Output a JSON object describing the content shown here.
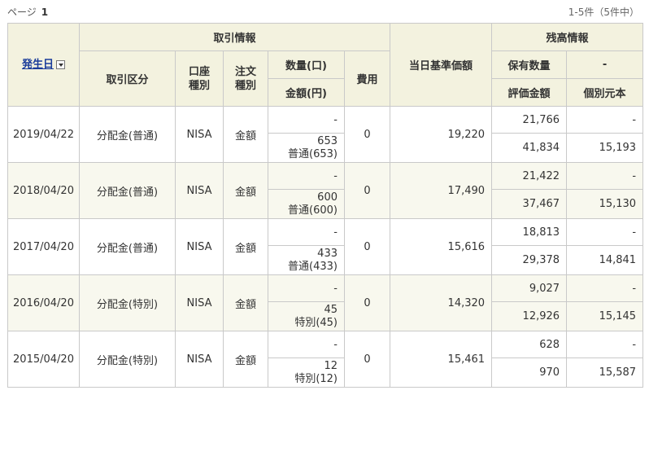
{
  "pager": {
    "label": "ページ",
    "current": "1",
    "count": "1-5件（5件中）"
  },
  "headers": {
    "date": "発生日",
    "torihiki_group": "取引情報",
    "torihiki_kubun": "取引区分",
    "koza": "口座\n種別",
    "chumon": "注文\n種別",
    "suryo": "数量(口)",
    "kingaku": "金額(円)",
    "hiyo": "費用",
    "kijun": "当日基準価額",
    "zandaka_group": "残高情報",
    "hoyu": "保有数量",
    "dash": "-",
    "hyoka": "評価金額",
    "kobetsu": "個別元本"
  },
  "rows": [
    {
      "date": "2019/04/22",
      "kubun": "分配金(普通)",
      "koza": "NISA",
      "chumon": "金額",
      "qty": "-",
      "amount": "653",
      "amount_detail": "普通(653)",
      "fee": "0",
      "nav": "19,220",
      "holding": "21,766",
      "dash": "-",
      "valuation": "41,834",
      "principal": "15,193"
    },
    {
      "date": "2018/04/20",
      "kubun": "分配金(普通)",
      "koza": "NISA",
      "chumon": "金額",
      "qty": "-",
      "amount": "600",
      "amount_detail": "普通(600)",
      "fee": "0",
      "nav": "17,490",
      "holding": "21,422",
      "dash": "-",
      "valuation": "37,467",
      "principal": "15,130"
    },
    {
      "date": "2017/04/20",
      "kubun": "分配金(普通)",
      "koza": "NISA",
      "chumon": "金額",
      "qty": "-",
      "amount": "433",
      "amount_detail": "普通(433)",
      "fee": "0",
      "nav": "15,616",
      "holding": "18,813",
      "dash": "-",
      "valuation": "29,378",
      "principal": "14,841"
    },
    {
      "date": "2016/04/20",
      "kubun": "分配金(特別)",
      "koza": "NISA",
      "chumon": "金額",
      "qty": "-",
      "amount": "45",
      "amount_detail": "特別(45)",
      "fee": "0",
      "nav": "14,320",
      "holding": "9,027",
      "dash": "-",
      "valuation": "12,926",
      "principal": "15,145"
    },
    {
      "date": "2015/04/20",
      "kubun": "分配金(特別)",
      "koza": "NISA",
      "chumon": "金額",
      "qty": "-",
      "amount": "12",
      "amount_detail": "特別(12)",
      "fee": "0",
      "nav": "15,461",
      "holding": "628",
      "dash": "-",
      "valuation": "970",
      "principal": "15,587"
    }
  ]
}
